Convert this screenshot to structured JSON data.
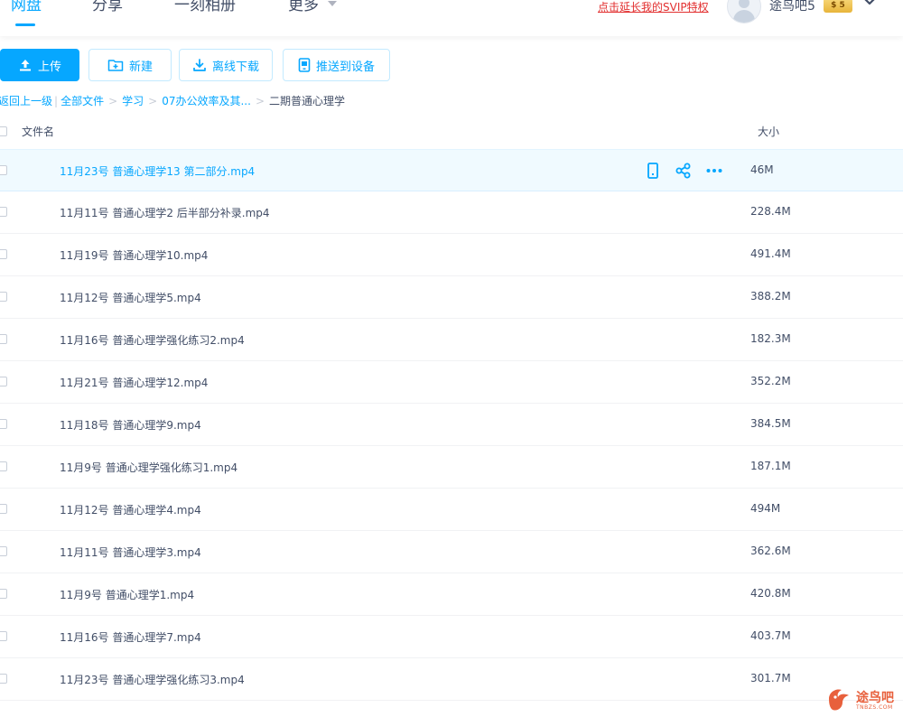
{
  "nav": {
    "tabs": [
      {
        "label": "网盘",
        "active": true
      },
      {
        "label": "分享",
        "active": false
      },
      {
        "label": "一刻相册",
        "active": false
      },
      {
        "label": "更多",
        "active": false
      }
    ],
    "svip_link": "点击延长我的SVIP特权",
    "username": "途鸟吧5",
    "vip_badge": "$ 5"
  },
  "toolbar": {
    "upload": "上传",
    "new": "新建",
    "offline_download": "离线下载",
    "push_to_device": "推送到设备"
  },
  "breadcrumb": {
    "back": "返回上一级",
    "all_files": "全部文件",
    "path": [
      "学习",
      "07办公效率及其..."
    ],
    "current": "二期普通心理学"
  },
  "table": {
    "col_name": "文件名",
    "col_size": "大小",
    "rows": [
      {
        "name": "11月23号 普通心理学13 第二部分.mp4",
        "size": "46M"
      },
      {
        "name": "11月11号 普通心理学2 后半部分补录.mp4",
        "size": "228.4M"
      },
      {
        "name": "11月19号 普通心理学10.mp4",
        "size": "491.4M"
      },
      {
        "name": "11月12号 普通心理学5.mp4",
        "size": "388.2M"
      },
      {
        "name": "11月16号 普通心理学强化练习2.mp4",
        "size": "182.3M"
      },
      {
        "name": "11月21号 普通心理学12.mp4",
        "size": "352.2M"
      },
      {
        "name": "11月18号 普通心理学9.mp4",
        "size": "384.5M"
      },
      {
        "name": "11月9号 普通心理学强化练习1.mp4",
        "size": "187.1M"
      },
      {
        "name": "11月12号 普通心理学4.mp4",
        "size": "494M"
      },
      {
        "name": "11月11号 普通心理学3.mp4",
        "size": "362.6M"
      },
      {
        "name": "11月9号 普通心理学1.mp4",
        "size": "420.8M"
      },
      {
        "name": "11月16号 普通心理学7.mp4",
        "size": "403.7M"
      },
      {
        "name": "11月23号 普通心理学强化练习3.mp4",
        "size": "301.7M"
      }
    ]
  },
  "watermark": {
    "text": "途鸟吧",
    "sub": "TNBZS.COM"
  },
  "colors": {
    "accent": "#06a7ff",
    "svip": "#e22f2f",
    "text": "#424e67"
  }
}
